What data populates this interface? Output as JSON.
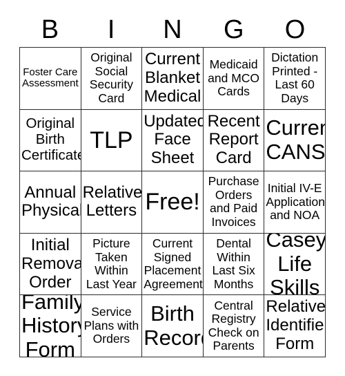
{
  "header": {
    "letters": [
      "B",
      "I",
      "N",
      "G",
      "O"
    ]
  },
  "grid": {
    "rows": 5,
    "columns": 5,
    "border_color": "#2b2b2b",
    "background_color": "#ffffff",
    "text_color": "#000000",
    "cells": [
      {
        "text": "Foster Care\nAssessment",
        "size": "sm"
      },
      {
        "text": "Original\nSocial\nSecurity\nCard",
        "size": "md"
      },
      {
        "text": "Current\nBlanket\nMedical",
        "size": "xl"
      },
      {
        "text": "Medicaid\nand MCO\nCards",
        "size": "md"
      },
      {
        "text": "Dictation\nPrinted -\nLast 60\nDays",
        "size": "md"
      },
      {
        "text": "Original\nBirth\nCertificate",
        "size": "lg"
      },
      {
        "text": "TLP",
        "size": "huge"
      },
      {
        "text": "Updated\nFace\nSheet",
        "size": "xl"
      },
      {
        "text": "Recent\nReport\nCard",
        "size": "xl"
      },
      {
        "text": "Current\nCANS",
        "size": "xxl"
      },
      {
        "text": "Annual\nPhysical",
        "size": "xl"
      },
      {
        "text": "Relative\nLetters",
        "size": "xl"
      },
      {
        "text": "Free!",
        "size": "huge"
      },
      {
        "text": "Purchase\nOrders\nand Paid\nInvoices",
        "size": "md"
      },
      {
        "text": "Initial IV-E\nApplication\nand NOA",
        "size": "md"
      },
      {
        "text": "Initial\nRemoval\nOrder",
        "size": "xl"
      },
      {
        "text": "Picture\nTaken\nWithin\nLast Year",
        "size": "md"
      },
      {
        "text": "Current\nSigned\nPlacement\nAgreement",
        "size": "md"
      },
      {
        "text": "Dental\nWithin\nLast Six\nMonths",
        "size": "md"
      },
      {
        "text": "Casey\nLife\nSkills",
        "size": "xxl"
      },
      {
        "text": "Family\nHistory\nForm",
        "size": "xxl"
      },
      {
        "text": "Service\nPlans with\nOrders",
        "size": "md"
      },
      {
        "text": "Birth\nRecord",
        "size": "xxl"
      },
      {
        "text": "Central\nRegistry\nCheck on\nParents",
        "size": "md"
      },
      {
        "text": "Relative\nIdentifier\nForm",
        "size": "xl"
      }
    ]
  }
}
